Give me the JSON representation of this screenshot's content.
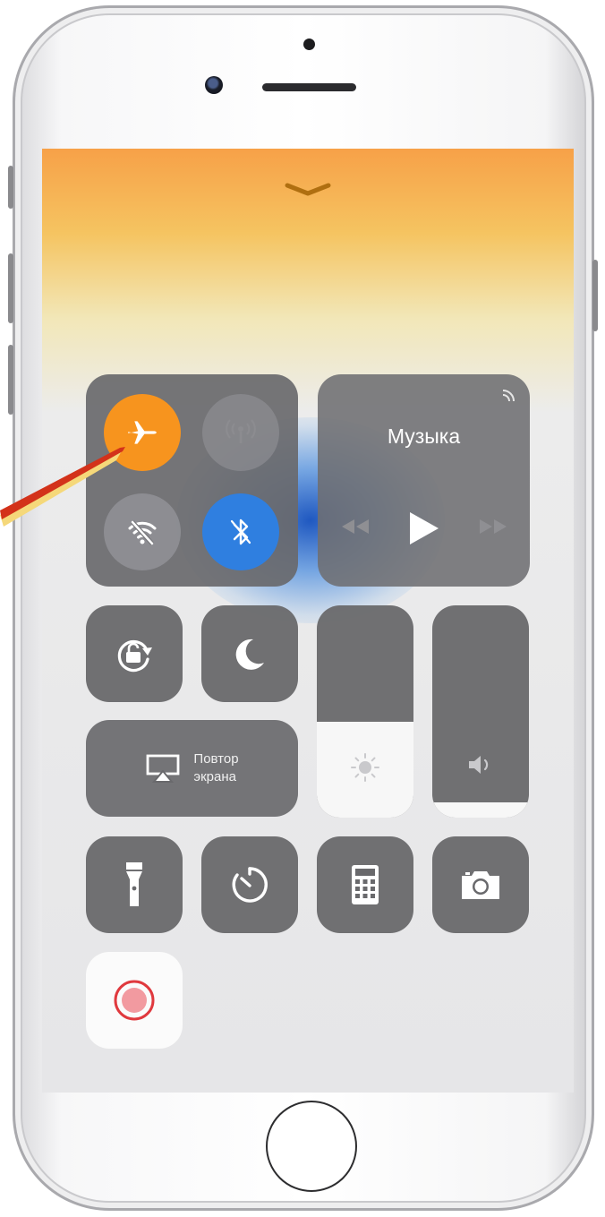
{
  "colors": {
    "airplane_active": "#f7941e",
    "bluetooth_active": "#2f7fe0",
    "tile_bg": "#69696c",
    "record_dot": "#e0393e",
    "arrow": "#d3321a"
  },
  "music": {
    "title": "Музыка"
  },
  "screen_mirroring": {
    "line1": "Повтор",
    "line2": "экрана"
  },
  "sliders": {
    "brightness_level": 0.45,
    "volume_level": 0.07
  },
  "icons": {
    "grabber": "chevron-down-icon",
    "airplane": "airplane-icon",
    "cellular": "antenna-icon",
    "wifi": "wifi-off-icon",
    "bluetooth": "bluetooth-icon",
    "airplay": "airplay-icon",
    "rewind": "rewind-icon",
    "play": "play-icon",
    "forward": "fast-forward-icon",
    "rotation_lock": "rotation-lock-icon",
    "do_not_disturb": "moon-icon",
    "screen_mirroring": "screen-mirroring-icon",
    "brightness": "sun-icon",
    "volume": "speaker-icon",
    "flashlight": "flashlight-icon",
    "timer": "timer-icon",
    "calculator": "calculator-icon",
    "camera": "camera-icon",
    "screen_record": "record-icon"
  }
}
